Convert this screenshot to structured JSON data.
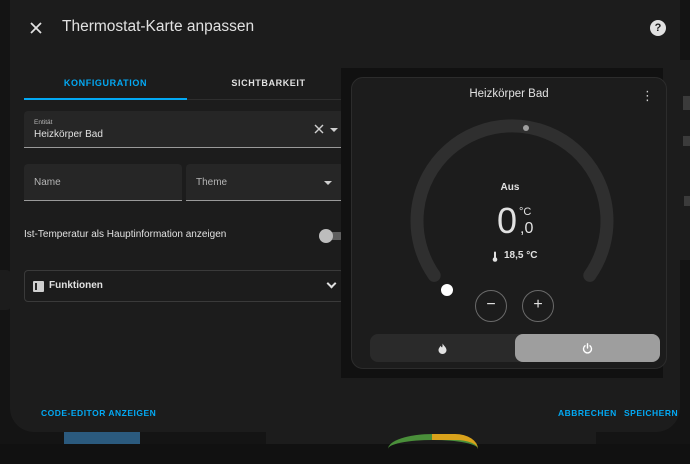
{
  "dialog": {
    "title": "Thermostat-Karte anpassen",
    "close_icon": "close-icon",
    "help_icon": "?"
  },
  "tabs": [
    {
      "label": "KONFIGURATION",
      "active": true
    },
    {
      "label": "SICHTBARKEIT",
      "active": false
    }
  ],
  "form": {
    "entity": {
      "label": "Entität",
      "value": "Heizkörper Bad"
    },
    "name": {
      "placeholder": "Name",
      "value": ""
    },
    "theme": {
      "placeholder": "Theme",
      "value": ""
    },
    "toggle": {
      "label": "Ist-Temperatur als Hauptinformation anzeigen",
      "on": false
    },
    "features": {
      "label": "Funktionen"
    }
  },
  "preview": {
    "title": "Heizkörper Bad",
    "menu_icon": "⋮",
    "mode": "Aus",
    "target_integer": "0",
    "target_unit": "°C",
    "target_decimal": ",0",
    "current_icon": "thermometer-icon",
    "current_temp": "18,5 °C",
    "minus": "−",
    "plus": "+",
    "modes": [
      {
        "name": "heat",
        "icon": "fire-icon",
        "selected": false
      },
      {
        "name": "off",
        "icon": "power-icon",
        "selected": true
      }
    ]
  },
  "footer": {
    "code_editor": "CODE-EDITOR ANZEIGEN",
    "cancel": "ABBRECHEN",
    "save": "SPEICHERN"
  },
  "colors": {
    "accent": "#03a9f4",
    "dialog_bg": "#1c1c1c",
    "mode_selected": "#9e9e9e"
  }
}
